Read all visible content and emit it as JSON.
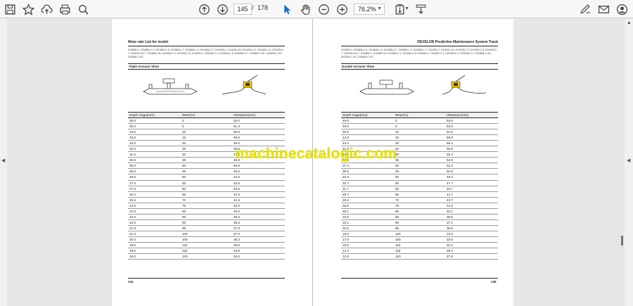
{
  "toolbar": {
    "page_current": "145",
    "page_separator": "/",
    "page_total": "178",
    "zoom": "76,2%",
    "icons": [
      "save-icon",
      "bookmark-star-icon",
      "upload-cloud-icon",
      "print-icon",
      "zoom-search-icon",
      "page-up-icon",
      "page-down-icon",
      "select-cursor-icon",
      "hand-icon",
      "zoom-out-icon",
      "zoom-in-icon",
      "fit-page-icon",
      "scroll-mode-icon",
      "sign-icon",
      "email-icon",
      "account-icon"
    ]
  },
  "watermark": "machinecatalogic.com",
  "left_page": {
    "header_left": "Wear rate List for model",
    "header_right": "",
    "models": "DX380LC, DX380LC-3, DX380LC-5, DX380LC-7, DX380LL-5, DX400LC-7, DX420LC, DX420LCA, DX420LC-3, DX420LC-5, DX420LC-7, DX420LCA-7, DX480LCA, DX480LC-3, DX490LC-5, DX520LC, DX530LC-3, DX530LC-5, DX530LC-7, DX380LC-9C, DX420LC-9C, DX500LC-9C",
    "section": "Triple Grouser Shoe",
    "columns": [
      "Depth Gage(mm)",
      "Wear(%)",
      "Ultrasonic(mm)"
    ],
    "rows": [
      [
        "36.0",
        "0",
        "53.0"
      ],
      [
        "35.3",
        "5",
        "51.3"
      ],
      [
        "34.5",
        "10",
        "50.5"
      ],
      [
        "33.8",
        "15",
        "49.0"
      ],
      [
        "33.0",
        "20",
        "49.0"
      ],
      [
        "32.3",
        "25",
        "48.0"
      ],
      [
        "31.5",
        "30",
        "47.3"
      ],
      [
        "30.8",
        "35",
        "46.8"
      ],
      [
        "30.0",
        "40",
        "46.0"
      ],
      [
        "29.3",
        "45",
        "45.3"
      ],
      [
        "28.5",
        "50",
        "44.5"
      ],
      [
        "27.0",
        "55",
        "43.8"
      ],
      [
        "27.0",
        "60",
        "43.0"
      ],
      [
        "26.3",
        "65",
        "42.3"
      ],
      [
        "25.5",
        "70",
        "41.5"
      ],
      [
        "24.8",
        "75",
        "40.0"
      ],
      [
        "24.0",
        "80",
        "40.0"
      ],
      [
        "23.3",
        "85",
        "38.3"
      ],
      [
        "22.5",
        "90",
        "38.5"
      ],
      [
        "21.8",
        "95",
        "37.8"
      ],
      [
        "21.0",
        "100",
        "37.0"
      ],
      [
        "20.3",
        "105",
        "36.3"
      ],
      [
        "19.5",
        "110",
        "35.5"
      ],
      [
        "18.0",
        "115",
        "34.8"
      ],
      [
        "18.0",
        "120",
        "34.0"
      ]
    ],
    "page_number": "144"
  },
  "right_page": {
    "header_left": "",
    "header_right": "DEVELON Predictive Maintenance System Track",
    "models": "DX380LC, DX380LC-3, DX380LC-5, DX380LC-7, DX380LL-5, DX400LC-7, DX420LC, DX420LCA, DX420LC-3, DX420LC-5, DX420LC-7, DX420LCA-7, DX480LC, DX480LCA, DX480LC-3, DX490LC-5, DX520LC, DX530LC-3, DX530LC-5, DX530LC-7, DX380LC-9C, DX420LC-9C, DX500LC-9C",
    "section": "Double Grouser Shoe",
    "columns": [
      "Depth Gage(mm)",
      "Wear(%)",
      "Ultrasonic(mm)"
    ],
    "rows": [
      [
        "49.5",
        "0",
        "64.5"
      ],
      [
        "48.0",
        "5",
        "63.0"
      ],
      [
        "46.5",
        "10",
        "61.5"
      ],
      [
        "44.9",
        "15",
        "59.9"
      ],
      [
        "43.4",
        "20",
        "58.4"
      ],
      [
        "41.9",
        "25",
        "56.9"
      ],
      [
        "40.4",
        "30",
        "55.4"
      ],
      [
        "38.8",
        "35",
        "53.8"
      ],
      [
        "37.3",
        "40",
        "52.3"
      ],
      [
        "35.8",
        "45",
        "50.8"
      ],
      [
        "34.3",
        "50",
        "49.3"
      ],
      [
        "32.7",
        "55",
        "47.7"
      ],
      [
        "31.7",
        "60",
        "46.7"
      ],
      [
        "29.7",
        "65",
        "44.7"
      ],
      [
        "28.2",
        "70",
        "43.7"
      ],
      [
        "26.6",
        "75",
        "41.6"
      ],
      [
        "25.1",
        "80",
        "40.1"
      ],
      [
        "23.6",
        "85",
        "38.6"
      ],
      [
        "22.1",
        "90",
        "37.1"
      ],
      [
        "20.5",
        "95",
        "35.5"
      ],
      [
        "19.0",
        "100",
        "34.0"
      ],
      [
        "17.5",
        "105",
        "32.5"
      ],
      [
        "16.0",
        "110",
        "31.0"
      ],
      [
        "14.4",
        "115",
        "29.4"
      ],
      [
        "12.9",
        "120",
        "27.9"
      ]
    ],
    "page_number": "145"
  }
}
